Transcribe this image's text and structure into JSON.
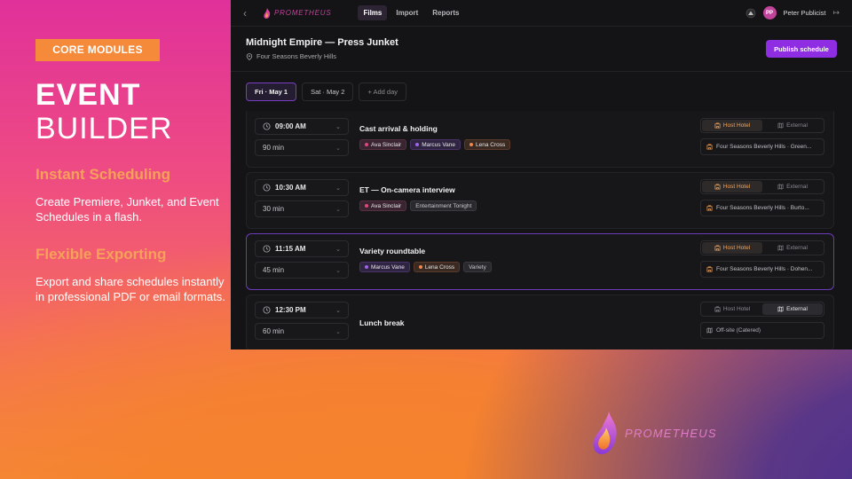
{
  "marketing": {
    "badge": "CORE MODULES",
    "title_bold": "EVENT",
    "title_light": "BUILDER",
    "features": [
      {
        "heading": "Instant Scheduling",
        "body": "Create Premiere, Junket, and Event Schedules in a flash."
      },
      {
        "heading": "Flexible Exporting",
        "body": "Export and share schedules instantly in professional PDF or email formats."
      }
    ]
  },
  "app": {
    "logo_text": "PROMETHEUS",
    "nav": [
      "Films",
      "Import",
      "Reports"
    ],
    "user": {
      "initials": "PP",
      "name": "Peter Publicist"
    },
    "event": {
      "title": "Midnight Empire — Press Junket",
      "venue": "Four Seasons Beverly Hills"
    },
    "publish_label": "Publish schedule",
    "days": [
      "Fri · May 1",
      "Sat · May 2",
      "+ Add day"
    ],
    "location_options": {
      "host": "Host Hotel",
      "external": "External"
    },
    "rows": [
      {
        "time": "09:00 AM",
        "duration": "90 min",
        "title": "Cast arrival & holding",
        "talent": [
          "Ava Sinclair",
          "Marcus Vane",
          "Lena Cross"
        ],
        "outlets": [],
        "location_mode": "host",
        "location": "Four Seasons Beverly Hills · Green..."
      },
      {
        "time": "10:30 AM",
        "duration": "30 min",
        "title": "ET — On-camera interview",
        "talent": [
          "Ava Sinclair"
        ],
        "outlets": [
          "Entertainment Tonight"
        ],
        "location_mode": "host",
        "location": "Four Seasons Beverly Hills · Burto..."
      },
      {
        "time": "11:15 AM",
        "duration": "45 min",
        "title": "Variety roundtable",
        "talent": [
          "Marcus Vane",
          "Lena Cross"
        ],
        "outlets": [
          "Variety"
        ],
        "location_mode": "host",
        "location": "Four Seasons Beverly Hills · Dohen..."
      },
      {
        "time": "12:30 PM",
        "duration": "60 min",
        "title": "Lunch break",
        "talent": [],
        "outlets": [],
        "location_mode": "external",
        "location": "Off-site (Catered)"
      }
    ],
    "talent_colors": {
      "Ava Sinclair": "#e0487a",
      "Marcus Vane": "#a064e8",
      "Lena Cross": "#ee8850"
    }
  },
  "brand": {
    "logo_text": "PROMETHEUS"
  }
}
